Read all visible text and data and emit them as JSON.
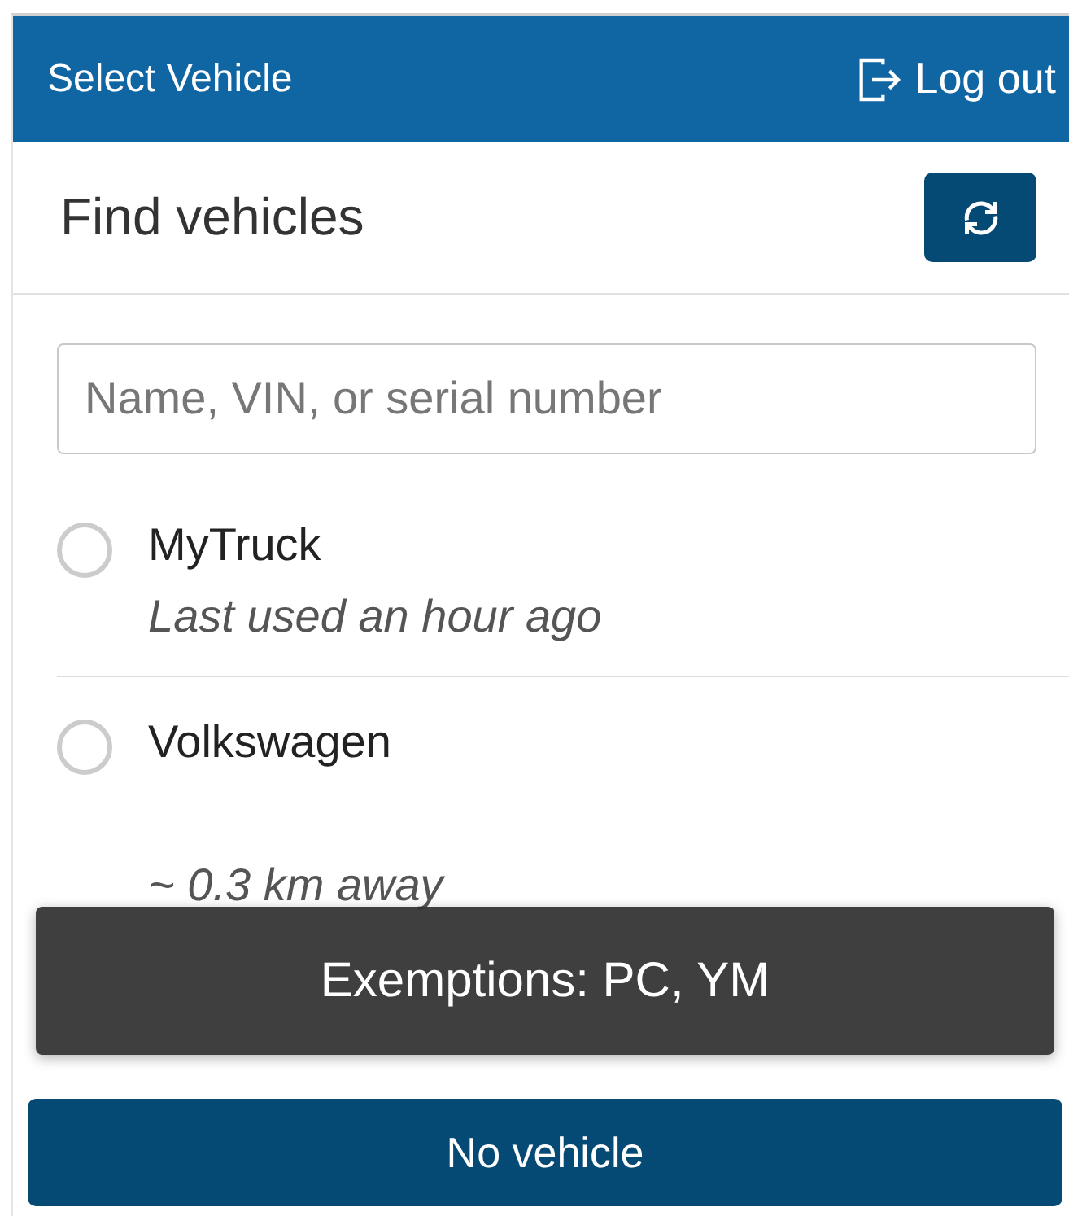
{
  "header": {
    "title": "Select Vehicle",
    "logout_label": "Log out"
  },
  "section": {
    "title": "Find vehicles"
  },
  "search": {
    "placeholder": "Name, VIN, or serial number"
  },
  "vehicles": [
    {
      "name": "MyTruck",
      "detail": "Last used an hour ago",
      "selected": false
    },
    {
      "name": "Volkswagen",
      "detail": "~ 0.3 km away",
      "selected": false
    }
  ],
  "toast": {
    "message": "Exemptions: PC, YM"
  },
  "footer_button": "No vehicle"
}
